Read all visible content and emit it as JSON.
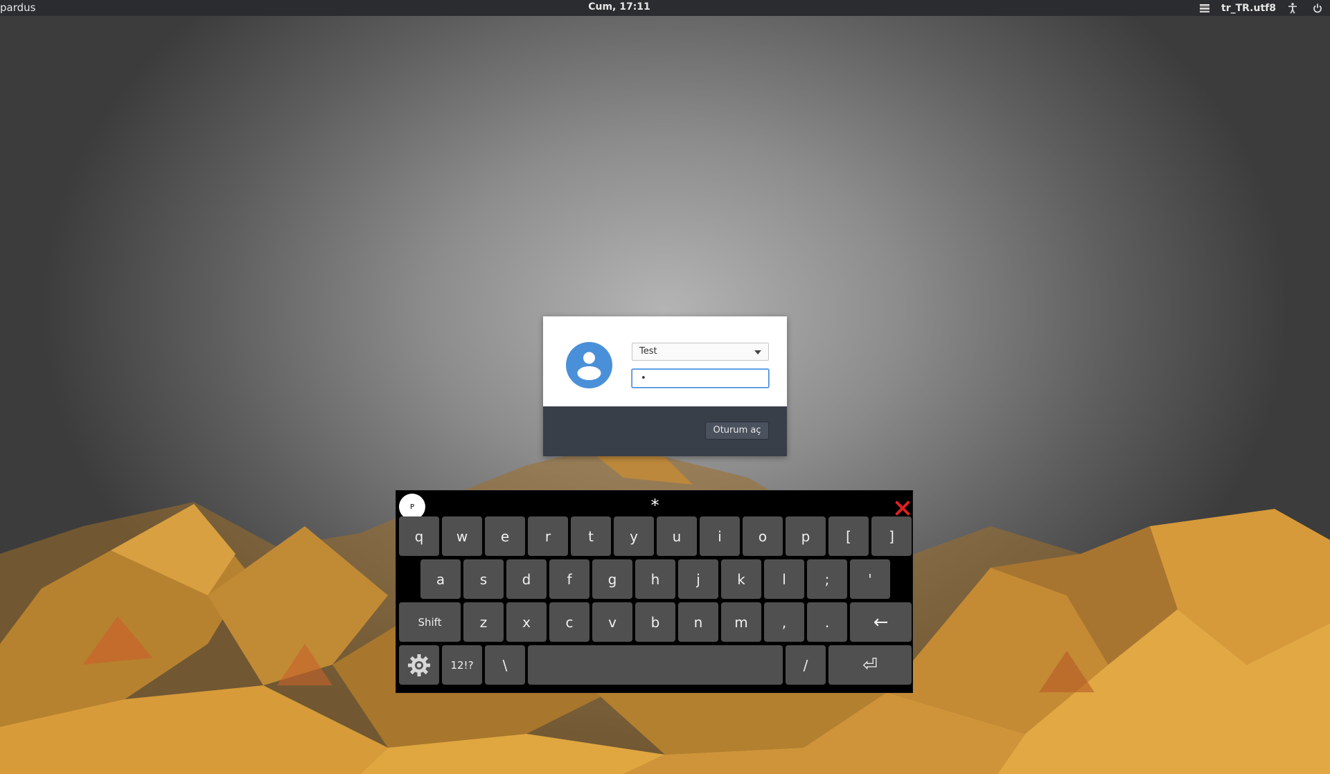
{
  "topbar": {
    "hostname": "pardus",
    "clock": "Cum, 17:11",
    "locale": "tr_TR.utf8",
    "icons": [
      "menu-icon",
      "accessibility-icon",
      "power-icon"
    ]
  },
  "login": {
    "username": "Test",
    "password_masked": "•",
    "login_button": "Oturum aç",
    "accent_color": "#4a90d9"
  },
  "keyboard": {
    "logo": "P",
    "preview": "*",
    "close_color": "#e02020",
    "row1": [
      "q",
      "w",
      "e",
      "r",
      "t",
      "y",
      "u",
      "i",
      "o",
      "p",
      "[",
      "]"
    ],
    "row2": [
      "a",
      "s",
      "d",
      "f",
      "g",
      "h",
      "j",
      "k",
      "l",
      ";",
      "'"
    ],
    "row3": [
      "Shift",
      "z",
      "x",
      "c",
      "v",
      "b",
      "n",
      "m",
      ",",
      ".",
      "←"
    ],
    "row4": [
      "settings-icon",
      "12!?",
      "\\",
      "",
      "/",
      "⏎"
    ]
  }
}
